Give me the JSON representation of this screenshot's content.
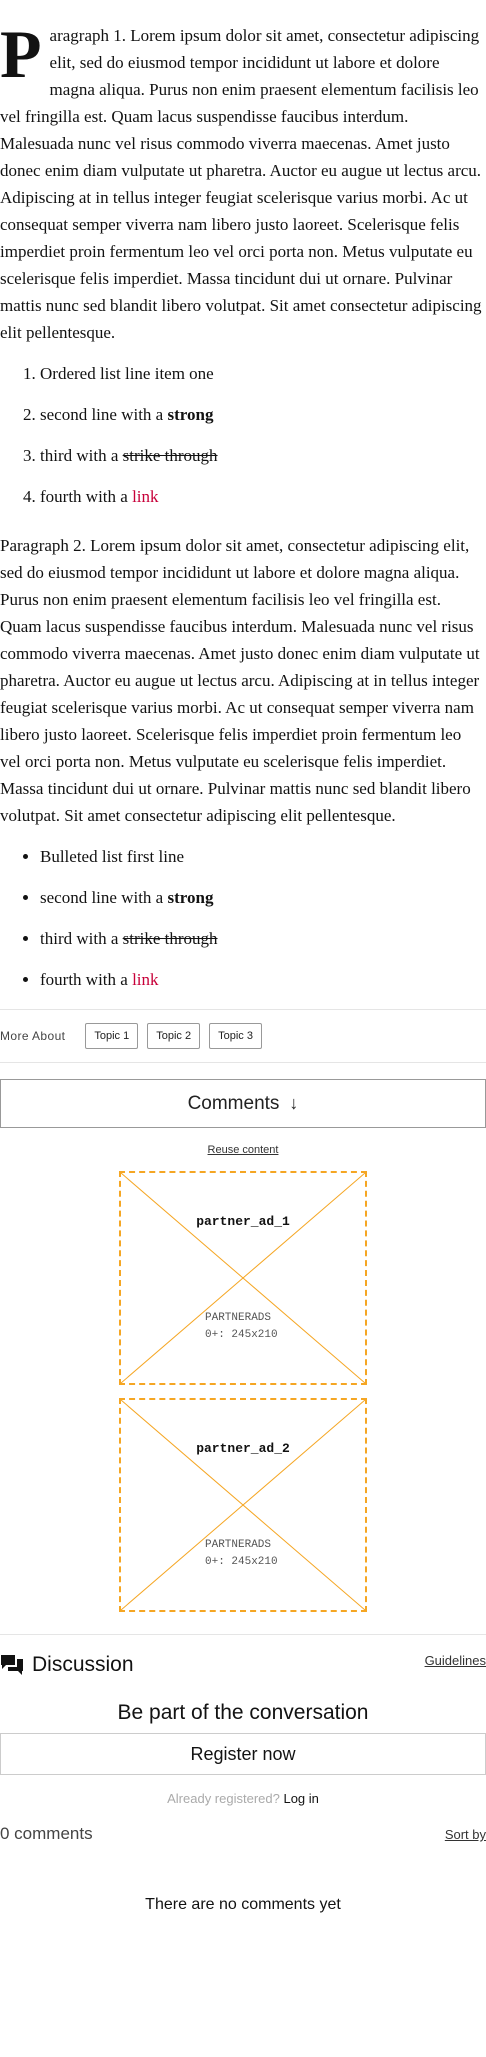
{
  "article": {
    "p1_dropcap": "P",
    "p1_text": "aragraph 1. Lorem ipsum dolor sit amet, consectetur adipiscing elit, sed do eiusmod tempor incididunt ut labore et dolore magna aliqua. Purus non enim praesent elementum facilisis leo vel fringilla est. Quam lacus suspendisse faucibus interdum. Malesuada nunc vel risus commodo viverra maecenas. Amet justo donec enim diam vulputate ut pharetra. Auctor eu augue ut lectus arcu. Adipiscing at in tellus integer feugiat scelerisque varius morbi. Ac ut consequat semper viverra nam libero justo laoreet. Scelerisque felis imperdiet proin fermentum leo vel orci porta non. Metus vulputate eu scelerisque felis imperdiet. Massa tincidunt dui ut ornare. Pulvinar mattis nunc sed blandit libero volutpat. Sit amet consectetur adipiscing elit pellentesque.",
    "ordered_list": {
      "item1": "Ordered list line item one",
      "item2_pre": "second line with a ",
      "item2_strong": "strong",
      "item3_pre": "third with a ",
      "item3_strike": "strike through",
      "item4_pre": "fourth with a ",
      "item4_link": "link"
    },
    "p2_text": "Paragraph 2. Lorem ipsum dolor sit amet, consectetur adipiscing elit, sed do eiusmod tempor incididunt ut labore et dolore magna aliqua. Purus non enim praesent elementum facilisis leo vel fringilla est. Quam lacus suspendisse faucibus interdum. Malesuada nunc vel risus commodo viverra maecenas. Amet justo donec enim diam vulputate ut pharetra. Auctor eu augue ut lectus arcu. Adipiscing at in tellus integer feugiat scelerisque varius morbi. Ac ut consequat semper viverra nam libero justo laoreet. Scelerisque felis imperdiet proin fermentum leo vel orci porta non. Metus vulputate eu scelerisque felis imperdiet. Massa tincidunt dui ut ornare. Pulvinar mattis nunc sed blandit libero volutpat. Sit amet consectetur adipiscing elit pellentesque.",
    "bulleted_list": {
      "item1": "Bulleted list first line",
      "item2_pre": "second line with a ",
      "item2_strong": "strong",
      "item3_pre": "third with a ",
      "item3_strike": "strike through",
      "item4_pre": "fourth with a ",
      "item4_link": "link"
    }
  },
  "more_about": {
    "label": "More About",
    "topics": [
      "Topic 1",
      "Topic 2",
      "Topic 3"
    ]
  },
  "comments_button": {
    "label": "Comments",
    "icon": "arrow-down-icon"
  },
  "reuse_content": "Reuse content",
  "ads": [
    {
      "name": "partner_ad_1",
      "network": "PARTNERADS",
      "size": "0+: 245x210"
    },
    {
      "name": "partner_ad_2",
      "network": "PARTNERADS",
      "size": "0+: 245x210"
    }
  ],
  "colors": {
    "ad_border": "#f5a623",
    "link": "#c70039"
  },
  "discussion": {
    "title": "Discussion",
    "icon": "discussion-icon",
    "guidelines": "Guidelines",
    "prompt": "Be part of the conversation",
    "register": "Register now",
    "already_registered": "Already registered?",
    "login": "Log in",
    "count": "0 comments",
    "sort_by": "Sort by",
    "empty": "There are no comments yet"
  }
}
